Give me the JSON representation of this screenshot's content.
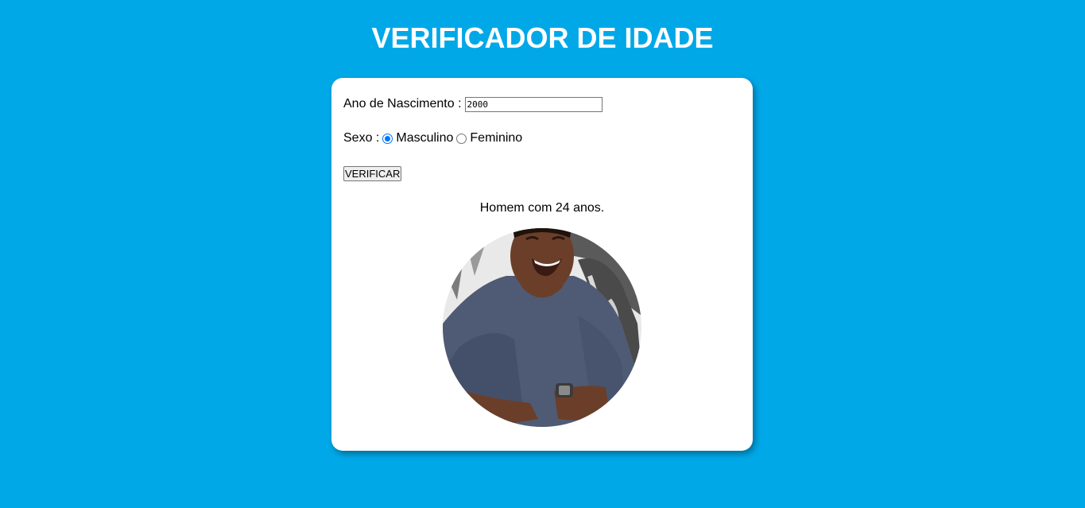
{
  "page": {
    "title": "VERIFICADOR DE IDADE"
  },
  "form": {
    "birth_label": "Ano de Nascimento :",
    "birth_value": "2000",
    "sex_label": "Sexo :",
    "options": [
      {
        "label": "Masculino",
        "checked": true
      },
      {
        "label": "Feminino",
        "checked": false
      }
    ],
    "verify_label": "VERIFICAR"
  },
  "result": {
    "text": "Homem com 24 anos.",
    "image_icon": "smiling-man-photo"
  },
  "colors": {
    "background": "#00a8e8",
    "card": "#ffffff",
    "radio_accent": "#0075ff"
  }
}
